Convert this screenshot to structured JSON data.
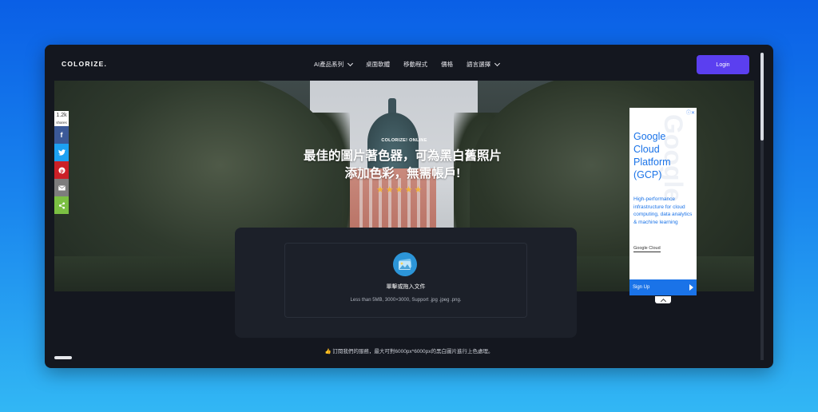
{
  "header": {
    "logo": "COLORIZE.",
    "nav": [
      {
        "label": "AI產品系列",
        "has_dropdown": true
      },
      {
        "label": "桌面軟體",
        "has_dropdown": false
      },
      {
        "label": "移動程式",
        "has_dropdown": false
      },
      {
        "label": "價格",
        "has_dropdown": false
      },
      {
        "label": "語言選擇",
        "has_dropdown": true
      }
    ],
    "login_label": "Login"
  },
  "hero": {
    "eyebrow": "COLORIZE! ONLINE",
    "title": "最佳的圖片著色器，可為黑白舊照片添加色彩，無需帳戶!",
    "rating_stars": 5
  },
  "upload": {
    "title": "單擊或拖入文件",
    "hint": "Less than 5MB, 3000×3000, Support .jpg .jpeg .png."
  },
  "subscribe_text": "👍 訂閱我們的服務，最大可對6000px*6000px的黑白圖片進行上色處理。",
  "share": {
    "count": "1.2k",
    "count_label": "shares"
  },
  "ad": {
    "info_icon": "ⓘ✕",
    "watermark": "Google",
    "title": "Google Cloud Platform (GCP)",
    "description": "High-performance infrastructure for cloud computing, data analytics & machine learning",
    "brand": "Google Cloud",
    "cta": "Sign Up"
  },
  "colors": {
    "accent": "#5b3ff0",
    "page_bg": "#14171f",
    "star": "#f1b23a"
  }
}
